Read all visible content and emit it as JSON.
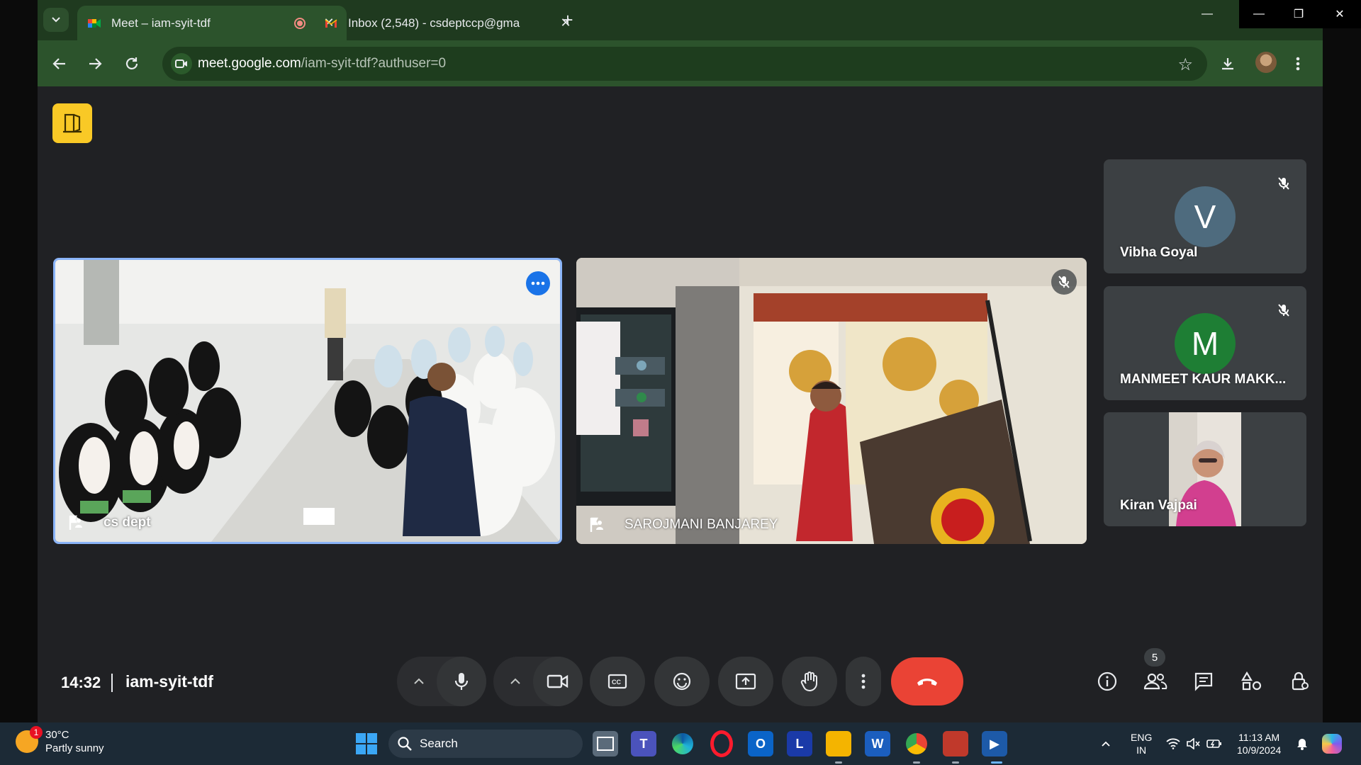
{
  "browser": {
    "tabs": [
      {
        "title": "Meet – iam-syit-tdf",
        "active": true
      },
      {
        "title": "Inbox (2,548) - csdeptccp@gma",
        "active": false
      }
    ],
    "url_host": "meet.google.com",
    "url_path": "/iam-syit-tdf?authuser=0",
    "colors": {
      "frame": "#1f3a1f",
      "toolbar": "#2c532c"
    }
  },
  "meet": {
    "participants": [
      {
        "name": "cs dept"
      },
      {
        "name": "SAROJMANI BANJAREY"
      },
      {
        "name": "Vibha Goyal",
        "initial": "V",
        "color": "#4e6b7e"
      },
      {
        "name": "MANMEET KAUR MAKK...",
        "initial": "M",
        "color": "#1e7e34"
      },
      {
        "name": "Kiran Vajpai"
      }
    ],
    "time": "14:32",
    "meeting_code": "iam-syit-tdf",
    "people_count": "5",
    "colors": {
      "hangup": "#ea4335",
      "active_border": "#8ab4f8",
      "logo": "#f9c926"
    }
  },
  "taskbar": {
    "weather_badge": "1",
    "temperature": "30°C",
    "weather_text": "Partly sunny",
    "search_label": "Search",
    "lang_top": "ENG",
    "lang_bottom": "IN",
    "clock_time": "11:13 AM",
    "clock_date": "10/9/2024"
  }
}
